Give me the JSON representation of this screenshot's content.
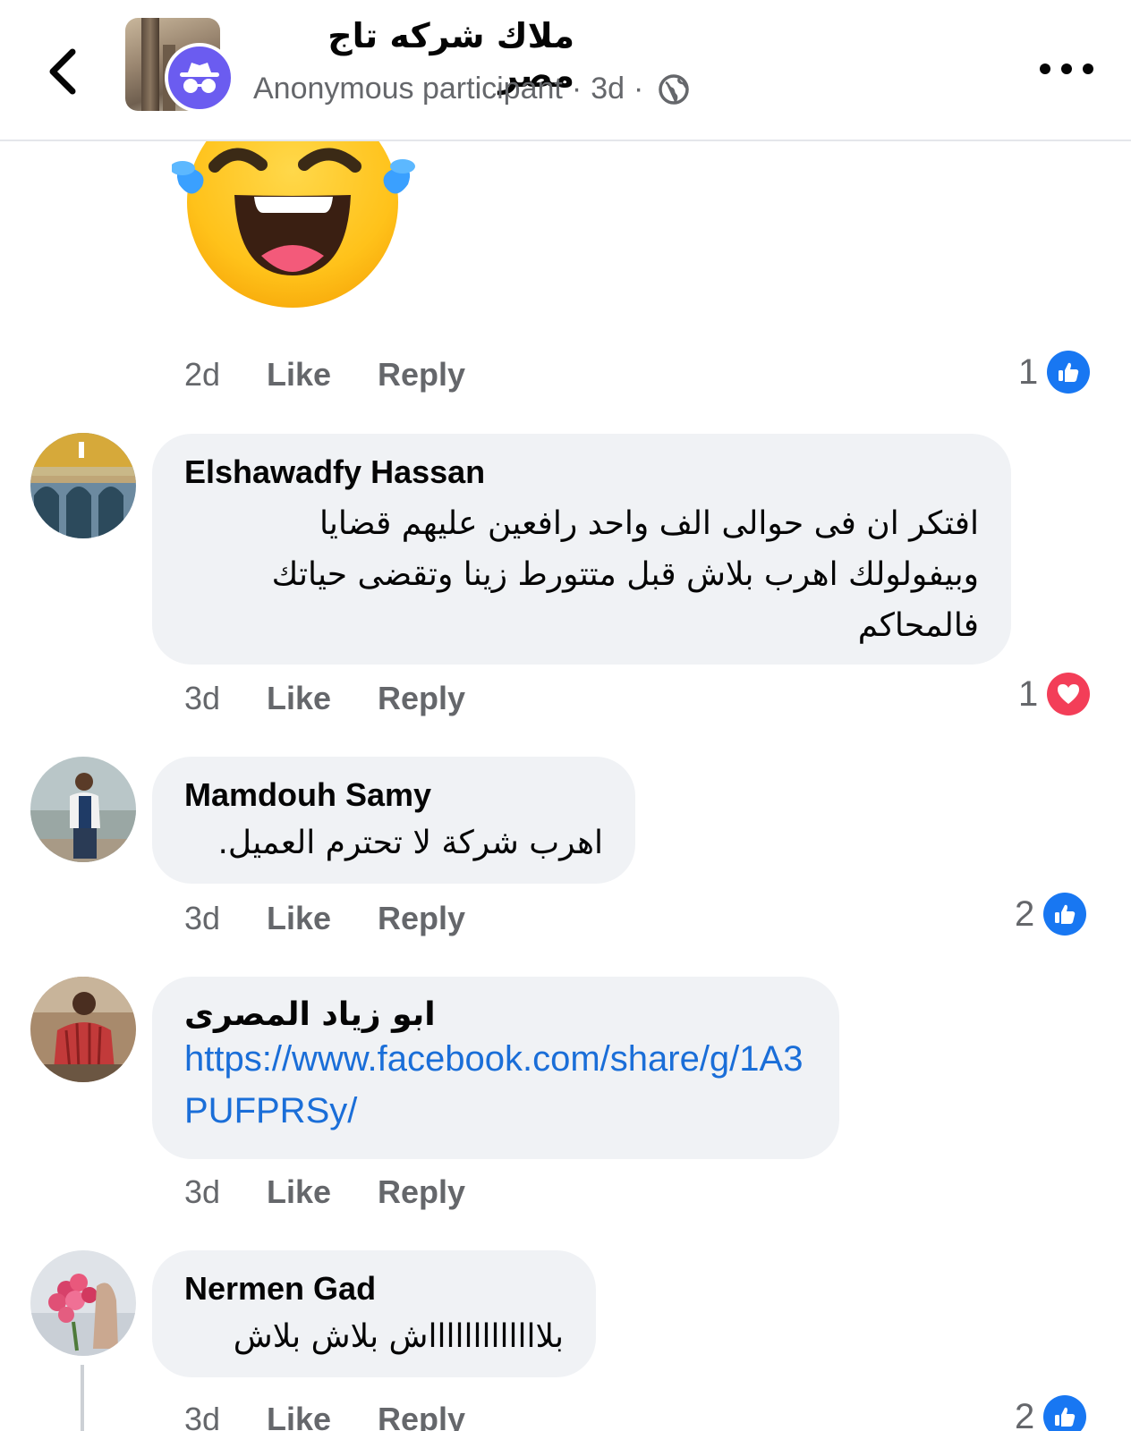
{
  "header": {
    "group_name": "ملاك شركه تاج مصر",
    "participant": "Anonymous participant",
    "separator": "·",
    "time": "3d",
    "icons": {
      "back": "chevron-left-icon",
      "privacy": "globe-icon",
      "more": "more-horizontal-icon",
      "anon": "incognito-icon"
    }
  },
  "actions": {
    "like_label": "Like",
    "reply_label": "Reply"
  },
  "emoji_comment": {
    "time": "2d",
    "reaction_count": "1",
    "reaction_type": "like",
    "sticker": "laughing-tears-emoji"
  },
  "comments": [
    {
      "author": "Elshawadfy Hassan",
      "lines": [
        "افتكر ان فى حوالى الف واحد رافعين عليهم قضايا",
        "وبيفولولك اهرب بلاش  قبل متتورط زينا وتقضى حياتك",
        "فالمحاكم"
      ],
      "time": "3d",
      "reaction_count": "1",
      "reaction_type": "love"
    },
    {
      "author": "Mamdouh Samy",
      "lines": [
        "اهرب شركة لا تحترم العميل."
      ],
      "time": "3d",
      "reaction_count": "2",
      "reaction_type": "like"
    },
    {
      "author": "ابو زياد المصرى",
      "link": "https://www.facebook.com/share/g/1A3PUFPRSy/",
      "time": "3d"
    },
    {
      "author": "Nermen Gad",
      "lines": [
        "بلاااااااااااااش بلاش بلاش"
      ],
      "time": "3d",
      "reaction_count": "2",
      "reaction_type": "like"
    }
  ],
  "colors": {
    "like_blue": "#1877f2",
    "love_red": "#f33e58",
    "bubble_bg": "#f0f2f5",
    "meta_gray": "#65676b",
    "link_blue": "#1a6ed8",
    "anon_purple": "#6b5cf0"
  }
}
